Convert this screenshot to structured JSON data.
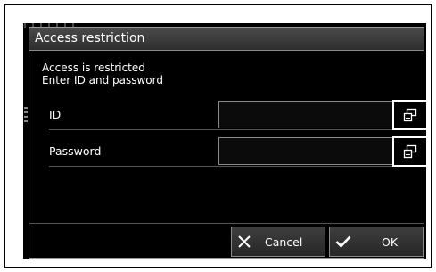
{
  "dialog": {
    "title": "Access restriction",
    "message_line1": "Access is restricted",
    "message_line2": "Enter ID and password"
  },
  "fields": {
    "id": {
      "label": "ID",
      "value": "",
      "keyboard_icon": "keyboard-window-icon"
    },
    "password": {
      "label": "Password",
      "value": "",
      "keyboard_icon": "keyboard-window-icon"
    }
  },
  "buttons": {
    "cancel": {
      "label": "Cancel",
      "icon": "close-icon"
    },
    "ok": {
      "label": "OK",
      "icon": "checkmark-icon"
    }
  },
  "colors": {
    "background": "#000000",
    "text": "#ffffff",
    "border": "#8a8a8a",
    "title_bar": "#3a3a3a"
  }
}
